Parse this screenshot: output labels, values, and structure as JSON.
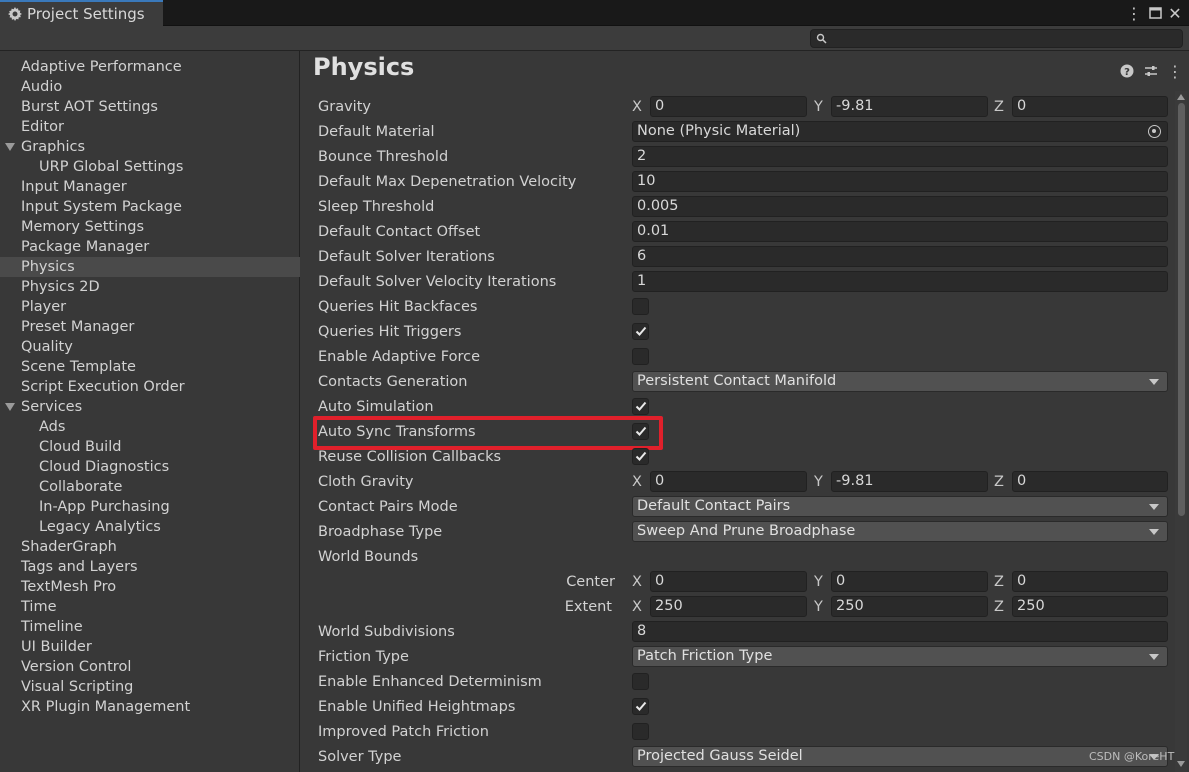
{
  "window": {
    "title": "Project Settings"
  },
  "sidebar": {
    "items": [
      {
        "label": "Adaptive Performance"
      },
      {
        "label": "Audio"
      },
      {
        "label": "Burst AOT Settings"
      },
      {
        "label": "Editor"
      },
      {
        "label": "Graphics",
        "expanded": true
      },
      {
        "label": "URP Global Settings",
        "child": true
      },
      {
        "label": "Input Manager"
      },
      {
        "label": "Input System Package"
      },
      {
        "label": "Memory Settings"
      },
      {
        "label": "Package Manager"
      },
      {
        "label": "Physics",
        "selected": true
      },
      {
        "label": "Physics 2D"
      },
      {
        "label": "Player"
      },
      {
        "label": "Preset Manager"
      },
      {
        "label": "Quality"
      },
      {
        "label": "Scene Template"
      },
      {
        "label": "Script Execution Order"
      },
      {
        "label": "Services",
        "expanded": true
      },
      {
        "label": "Ads",
        "child": true
      },
      {
        "label": "Cloud Build",
        "child": true
      },
      {
        "label": "Cloud Diagnostics",
        "child": true
      },
      {
        "label": "Collaborate",
        "child": true
      },
      {
        "label": "In-App Purchasing",
        "child": true
      },
      {
        "label": "Legacy Analytics",
        "child": true
      },
      {
        "label": "ShaderGraph"
      },
      {
        "label": "Tags and Layers"
      },
      {
        "label": "TextMesh Pro"
      },
      {
        "label": "Time"
      },
      {
        "label": "Timeline"
      },
      {
        "label": "UI Builder"
      },
      {
        "label": "Version Control"
      },
      {
        "label": "Visual Scripting"
      },
      {
        "label": "XR Plugin Management"
      }
    ]
  },
  "main": {
    "title": "Physics",
    "gravity": {
      "label": "Gravity",
      "x": "0",
      "y": "-9.81",
      "z": "0"
    },
    "default_material": {
      "label": "Default Material",
      "value": "None (Physic Material)"
    },
    "bounce_threshold": {
      "label": "Bounce Threshold",
      "value": "2"
    },
    "max_depenetration": {
      "label": "Default Max Depenetration Velocity",
      "value": "10"
    },
    "sleep_threshold": {
      "label": "Sleep Threshold",
      "value": "0.005"
    },
    "contact_offset": {
      "label": "Default Contact Offset",
      "value": "0.01"
    },
    "solver_iterations": {
      "label": "Default Solver Iterations",
      "value": "6"
    },
    "solver_velocity_iterations": {
      "label": "Default Solver Velocity Iterations",
      "value": "1"
    },
    "queries_hit_backfaces": {
      "label": "Queries Hit Backfaces",
      "checked": false
    },
    "queries_hit_triggers": {
      "label": "Queries Hit Triggers",
      "checked": true
    },
    "enable_adaptive_force": {
      "label": "Enable Adaptive Force",
      "checked": false
    },
    "contacts_generation": {
      "label": "Contacts Generation",
      "value": "Persistent Contact Manifold"
    },
    "auto_simulation": {
      "label": "Auto Simulation",
      "checked": true
    },
    "auto_sync_transforms": {
      "label": "Auto Sync Transforms",
      "checked": true
    },
    "reuse_collision_callbacks": {
      "label": "Reuse Collision Callbacks",
      "checked": true
    },
    "cloth_gravity": {
      "label": "Cloth Gravity",
      "x": "0",
      "y": "-9.81",
      "z": "0"
    },
    "contact_pairs_mode": {
      "label": "Contact Pairs Mode",
      "value": "Default Contact Pairs"
    },
    "broadphase_type": {
      "label": "Broadphase Type",
      "value": "Sweep And Prune Broadphase"
    },
    "world_bounds": {
      "label": "World Bounds",
      "center": {
        "label": "Center",
        "x": "0",
        "y": "0",
        "z": "0"
      },
      "extent": {
        "label": "Extent",
        "x": "250",
        "y": "250",
        "z": "250"
      }
    },
    "world_subdivisions": {
      "label": "World Subdivisions",
      "value": "8"
    },
    "friction_type": {
      "label": "Friction Type",
      "value": "Patch Friction Type"
    },
    "enhanced_determinism": {
      "label": "Enable Enhanced Determinism",
      "checked": false
    },
    "unified_heightmaps": {
      "label": "Enable Unified Heightmaps",
      "checked": true
    },
    "improved_patch_friction": {
      "label": "Improved Patch Friction",
      "checked": false
    },
    "solver_type": {
      "label": "Solver Type",
      "value": "Projected Gauss Seidel"
    },
    "axis": {
      "x": "X",
      "y": "Y",
      "z": "Z"
    }
  },
  "watermark": "CSDN @KoreHT",
  "colors": {
    "highlight": "#e0202b",
    "tab_accent": "#3a79bb"
  }
}
